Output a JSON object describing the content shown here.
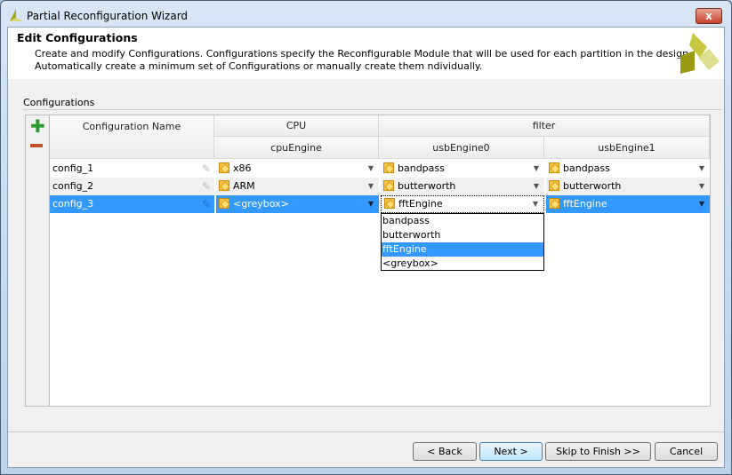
{
  "window": {
    "title": "Partial Reconfiguration Wizard",
    "close": "x"
  },
  "header": {
    "title": "Edit Configurations",
    "desc1": "Create and modify Configurations. Configurations specify the Reconfigurable Module that will be used for each partition in the design.",
    "desc2": "Automatically create a minimum set of Configurations or manually create them ndividually."
  },
  "section": {
    "label": "Configurations"
  },
  "table": {
    "col_name": "Configuration Name",
    "group_cpu": "CPU",
    "group_filter": "filter",
    "columns": [
      "cpuEngine",
      "usbEngine0",
      "usbEngine1"
    ],
    "rows": [
      {
        "name": "config_1",
        "cells": [
          "x86",
          "bandpass",
          "bandpass"
        ]
      },
      {
        "name": "config_2",
        "cells": [
          "ARM",
          "butterworth",
          "butterworth"
        ]
      },
      {
        "name": "config_3",
        "cells": [
          "<greybox>",
          "fftEngine",
          "fftEngine"
        ]
      }
    ]
  },
  "dropdown": {
    "options": [
      "bandpass",
      "butterworth",
      "fftEngine",
      "<greybox>"
    ],
    "selected": "fftEngine"
  },
  "buttons": {
    "back": "< Back",
    "next": "Next >",
    "skip": "Skip to Finish >>",
    "cancel": "Cancel"
  }
}
